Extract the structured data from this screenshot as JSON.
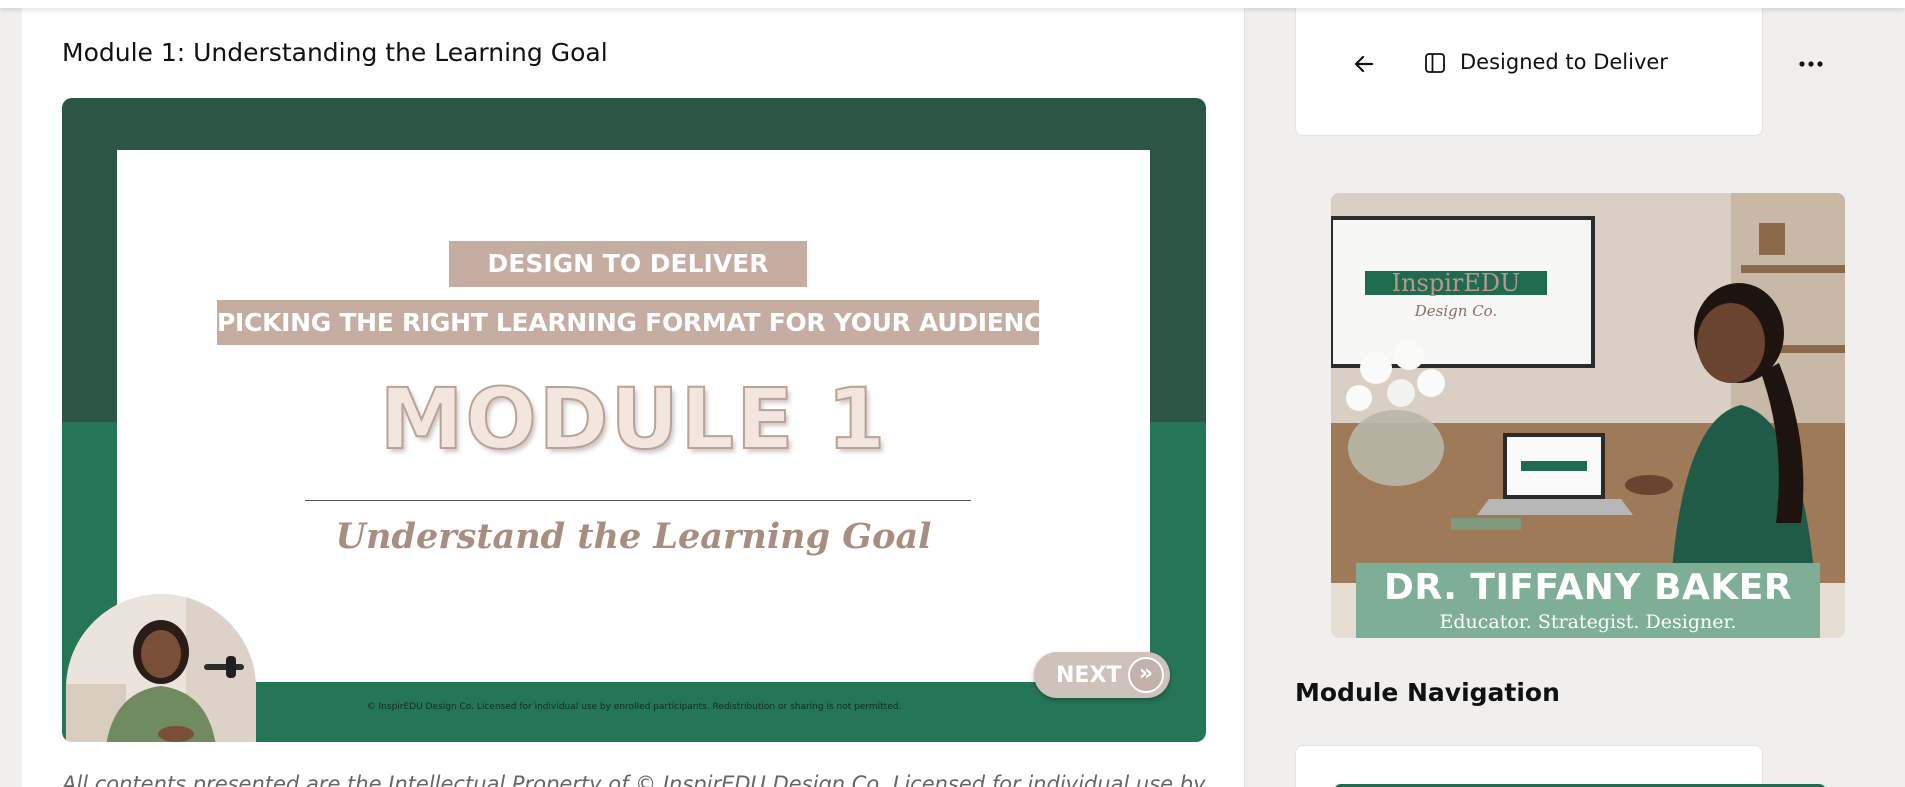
{
  "main": {
    "module_title": "Module 1: Understanding the Learning Goal",
    "slide": {
      "banner_1": "DESIGN TO DELIVER",
      "banner_2": "PICKING THE RIGHT LEARNING FORMAT FOR YOUR AUDIENCE",
      "module_heading": "MODULE 1",
      "subtitle": "Understand the Learning Goal",
      "copyright": "© InspirEDU Design Co. Licensed for individual use by enrolled participants. Redistribution or sharing is not permitted.",
      "next_label": "NEXT",
      "next_icon": "double-chevron-right-icon"
    },
    "ip_notice": "All contents presented are the Intellectual Property of © InspirEDU Design Co. Licensed for individual use by"
  },
  "sidebar": {
    "title": "Designed to Deliver",
    "back_icon": "arrow-left-icon",
    "panel_icon": "sidebar-panel-icon",
    "more_icon": "more-horizontal-icon",
    "instructor": {
      "logo_text": "InspirEDU",
      "logo_script": "Design Co.",
      "name": "DR. TIFFANY BAKER",
      "tagline": "Educator. Strategist. Designer."
    },
    "nav_heading": "Module Navigation"
  },
  "colors": {
    "accent_green": "#257656",
    "dark_green": "#2b5545",
    "banner_taupe": "#c5ada2",
    "instructor_banner": "#7fae97"
  }
}
